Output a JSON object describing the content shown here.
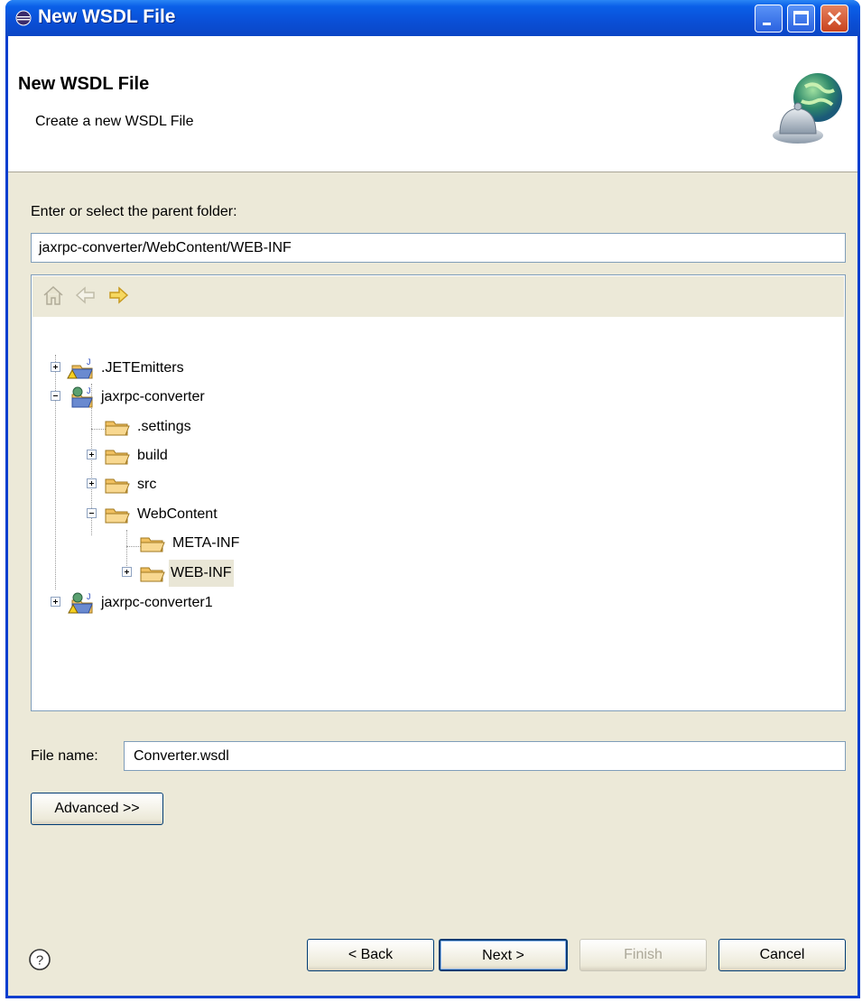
{
  "window": {
    "title": "New WSDL File"
  },
  "banner": {
    "title": "New WSDL File",
    "description": "Create a new WSDL File",
    "icon": "globe-bell-icon"
  },
  "folder": {
    "label": "Enter or select the parent folder:",
    "value": "jaxrpc-converter/WebContent/WEB-INF"
  },
  "tree_toolbar": {
    "home": "home-icon",
    "back": "back-arrow-icon",
    "forward": "forward-arrow-icon"
  },
  "tree": {
    "items": [
      {
        "label": ".JETEmitters",
        "icon": "project-icon",
        "expander": "+"
      },
      {
        "label": "jaxrpc-converter",
        "icon": "web-project-icon",
        "expander": "-"
      },
      {
        "label": ".settings",
        "icon": "folder-icon",
        "expander": ""
      },
      {
        "label": "build",
        "icon": "folder-icon",
        "expander": "+"
      },
      {
        "label": "src",
        "icon": "folder-icon",
        "expander": "+"
      },
      {
        "label": "WebContent",
        "icon": "folder-icon",
        "expander": "-"
      },
      {
        "label": "META-INF",
        "icon": "folder-icon",
        "expander": ""
      },
      {
        "label": "WEB-INF",
        "icon": "folder-icon",
        "expander": "+",
        "selected": true
      },
      {
        "label": "jaxrpc-converter1",
        "icon": "web-project-icon",
        "expander": "+"
      }
    ]
  },
  "filename": {
    "label": "File name:",
    "value": "Converter.wsdl"
  },
  "buttons": {
    "advanced": "Advanced >>",
    "back": "< Back",
    "next": "Next >",
    "finish": "Finish",
    "cancel": "Cancel"
  },
  "colors": {
    "titlebar": "#0a4fd6",
    "dialog_bg": "#ece9d8",
    "folder": "#f0c060"
  }
}
